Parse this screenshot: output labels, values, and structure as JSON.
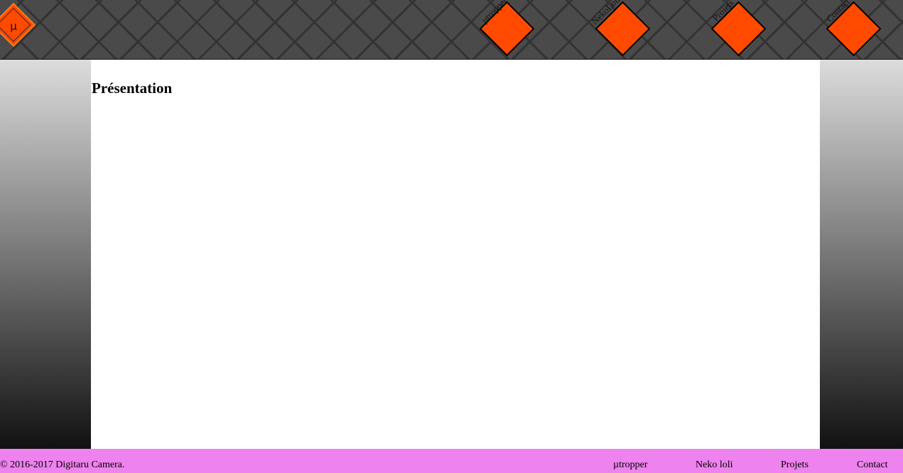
{
  "header": {
    "logo_text": "µ",
    "nav": [
      {
        "label": "µtropper"
      },
      {
        "label": "NekoLoli"
      },
      {
        "label": "Projets"
      },
      {
        "label": "Contact"
      }
    ]
  },
  "main": {
    "title": "Présentation"
  },
  "footer": {
    "copyright": "© 2016-2017 Digitaru Camera.",
    "links": [
      {
        "label": "µtropper"
      },
      {
        "label": "Neko loli"
      },
      {
        "label": "Projets"
      },
      {
        "label": "Contact"
      }
    ]
  },
  "colors": {
    "accent": "#ff4a00",
    "header_bg": "#4a4a4a",
    "footer_bg": "#ee82ee"
  }
}
